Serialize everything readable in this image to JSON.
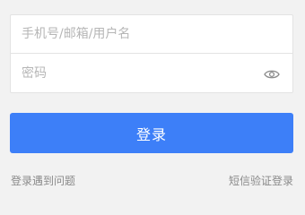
{
  "form": {
    "username_placeholder": "手机号/邮箱/用户名",
    "username_value": "",
    "password_placeholder": "密码",
    "password_value": "",
    "password_toggle_icon": "eye-icon"
  },
  "actions": {
    "login_label": "登录",
    "trouble_link": "登录遇到问题",
    "sms_login_link": "短信验证登录"
  },
  "colors": {
    "primary": "#3d7ff8",
    "background": "#f2f2f2",
    "link_text": "#8a8a8a",
    "placeholder": "#b6b6b6"
  }
}
